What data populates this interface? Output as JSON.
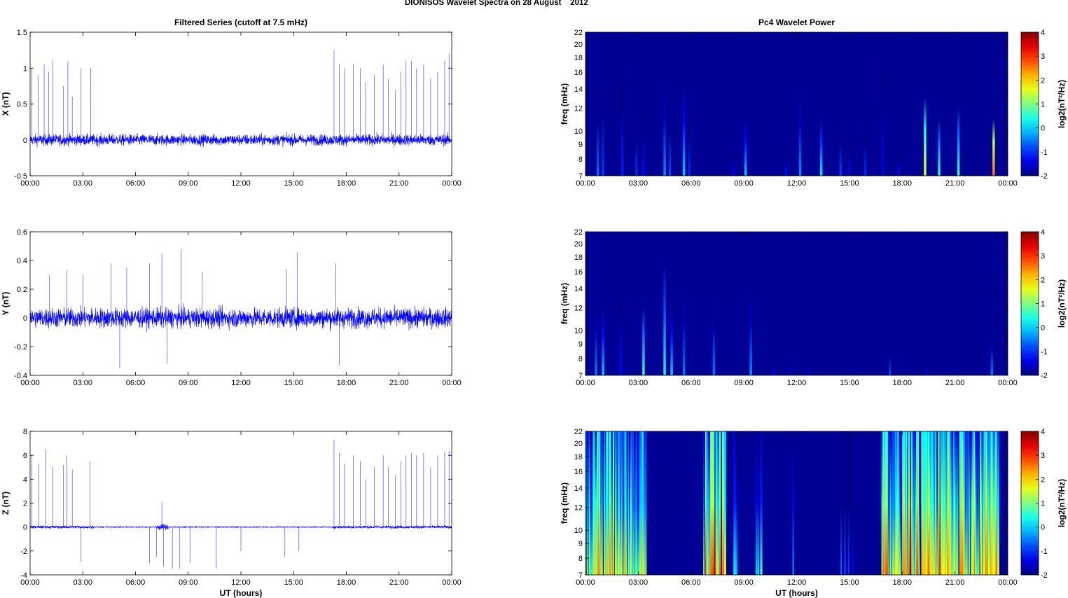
{
  "figure_title": "DIONISOS Wavelet Spectra on 28 August    2012",
  "chart_data": [
    {
      "type": "line",
      "panel": "x-series",
      "title": "Filtered Series (cutoff at 7.5 mHz)",
      "xlabel": "",
      "ylabel": "X (nT)",
      "xlim": [
        0,
        24
      ],
      "ylim": [
        -0.5,
        1.5
      ],
      "yticks": [
        "-0.5",
        "0",
        "0.5",
        "1",
        "1.5"
      ],
      "yticks_values": [
        -0.5,
        0,
        0.5,
        1,
        1.5
      ],
      "noise_amplitude": 0.08,
      "spikes": [
        [
          0.1,
          1.0
        ],
        [
          0.45,
          0.9
        ],
        [
          0.8,
          1.05
        ],
        [
          1.05,
          0.95
        ],
        [
          1.3,
          1.1
        ],
        [
          1.9,
          0.75
        ],
        [
          2.15,
          1.1
        ],
        [
          2.4,
          0.6
        ],
        [
          2.9,
          1.0
        ],
        [
          3.45,
          1.0
        ],
        [
          17.3,
          1.25
        ],
        [
          17.6,
          1.05
        ],
        [
          17.9,
          1.0
        ],
        [
          18.4,
          1.05
        ],
        [
          18.8,
          1.0
        ],
        [
          19.1,
          0.8
        ],
        [
          19.6,
          0.9
        ],
        [
          20.1,
          1.05
        ],
        [
          20.4,
          0.85
        ],
        [
          20.8,
          0.7
        ],
        [
          21.1,
          0.95
        ],
        [
          21.4,
          1.1
        ],
        [
          21.7,
          1.1
        ],
        [
          22.0,
          1.0
        ],
        [
          22.4,
          1.05
        ],
        [
          22.8,
          0.85
        ],
        [
          23.2,
          0.95
        ],
        [
          23.6,
          1.1
        ],
        [
          23.85,
          1.2
        ]
      ]
    },
    {
      "type": "line",
      "panel": "y-series",
      "title": "",
      "xlabel": "",
      "ylabel": "Y (nT)",
      "xlim": [
        0,
        24
      ],
      "ylim": [
        -0.4,
        0.6
      ],
      "yticks": [
        "-0.4",
        "-0.2",
        "0",
        "0.2",
        "0.4",
        "0.6"
      ],
      "yticks_values": [
        -0.4,
        -0.2,
        0,
        0.2,
        0.4,
        0.6
      ],
      "noise_amplitude": 0.07,
      "spikes": [
        [
          2.1,
          0.33
        ],
        [
          3.0,
          0.3
        ],
        [
          4.6,
          0.38
        ],
        [
          5.1,
          -0.35
        ],
        [
          6.8,
          0.38
        ],
        [
          7.5,
          0.45
        ],
        [
          7.8,
          -0.32
        ],
        [
          8.6,
          0.48
        ],
        [
          9.8,
          0.32
        ],
        [
          14.6,
          0.34
        ],
        [
          15.2,
          0.46
        ],
        [
          17.4,
          0.38
        ],
        [
          17.6,
          -0.33
        ],
        [
          5.5,
          0.35
        ],
        [
          1.1,
          0.3
        ]
      ]
    },
    {
      "type": "line",
      "panel": "z-series",
      "title": "",
      "xlabel": "UT (hours)",
      "ylabel": "Z (nT)",
      "xlim": [
        0,
        24
      ],
      "ylim": [
        -4,
        8
      ],
      "yticks": [
        "-4",
        "-2",
        "0",
        "2",
        "4",
        "6",
        "8"
      ],
      "yticks_values": [
        -4,
        -2,
        0,
        2,
        4,
        6,
        8
      ],
      "noise_amplitude": 0.12,
      "spikes": [
        [
          0.1,
          6.0
        ],
        [
          0.5,
          5.3
        ],
        [
          0.9,
          6.5
        ],
        [
          1.3,
          5.0
        ],
        [
          1.9,
          5.2
        ],
        [
          2.1,
          6.0
        ],
        [
          2.4,
          4.8
        ],
        [
          2.9,
          -2.9
        ],
        [
          3.4,
          5.5
        ],
        [
          6.8,
          -3.0
        ],
        [
          7.2,
          -2.5
        ],
        [
          7.5,
          2.1
        ],
        [
          7.6,
          -3.3
        ],
        [
          8.1,
          -3.5
        ],
        [
          8.5,
          -3.5
        ],
        [
          9.1,
          -3.0
        ],
        [
          10.6,
          -3.5
        ],
        [
          12.0,
          -2.0
        ],
        [
          14.5,
          -2.5
        ],
        [
          15.3,
          -2.0
        ],
        [
          17.3,
          7.3
        ],
        [
          17.6,
          6.2
        ],
        [
          17.9,
          5.3
        ],
        [
          18.4,
          6.0
        ],
        [
          18.8,
          5.5
        ],
        [
          19.1,
          4.0
        ],
        [
          19.6,
          5.0
        ],
        [
          20.1,
          6.0
        ],
        [
          20.4,
          5.0
        ],
        [
          20.8,
          4.3
        ],
        [
          21.1,
          5.5
        ],
        [
          21.4,
          6.0
        ],
        [
          21.7,
          6.2
        ],
        [
          22.0,
          6.0
        ],
        [
          22.4,
          6.2
        ],
        [
          22.8,
          5.0
        ],
        [
          23.2,
          6.0
        ],
        [
          23.6,
          6.3
        ],
        [
          23.85,
          6.4
        ]
      ]
    },
    {
      "type": "heatmap",
      "panel": "x-power",
      "title": "Pc4 Wavelet Power",
      "xlabel": "",
      "ylabel": "freq (mHz)",
      "xlim": [
        0,
        24
      ],
      "ylim": [
        7,
        22
      ],
      "yscale": "log",
      "yticks": [
        "7",
        "8",
        "9",
        "10",
        "12",
        "14",
        "16",
        "18",
        "20",
        "22"
      ],
      "yticks_values": [
        7,
        8,
        9,
        10,
        12,
        14,
        16,
        18,
        20,
        22
      ],
      "colorbar": {
        "label": "log2(nT²/Hz)",
        "ticks": [
          "-2",
          "-1",
          "0",
          "1",
          "2",
          "3",
          "4"
        ],
        "clim": [
          -2,
          4
        ],
        "colormap": "jet"
      },
      "bursts": [
        [
          0.7,
          14,
          -0.6
        ],
        [
          1.0,
          16,
          -0.9
        ],
        [
          2.1,
          18,
          -1.1
        ],
        [
          2.9,
          12,
          -1.0
        ],
        [
          3.3,
          13,
          -1.2
        ],
        [
          4.5,
          15,
          -0.4
        ],
        [
          4.8,
          13,
          -0.8
        ],
        [
          5.6,
          14,
          0.0
        ],
        [
          5.9,
          12,
          -1.0
        ],
        [
          8.4,
          9,
          -1.3
        ],
        [
          9.1,
          11,
          0.0
        ],
        [
          11.4,
          9,
          -1.2
        ],
        [
          12.2,
          14,
          -0.4
        ],
        [
          13.4,
          11,
          0.2
        ],
        [
          14.5,
          11,
          -0.9
        ],
        [
          15.0,
          10,
          -1.2
        ],
        [
          15.9,
          11,
          -1.0
        ],
        [
          16.9,
          22,
          -1.4
        ],
        [
          17.8,
          9,
          -1.2
        ],
        [
          19.3,
          13,
          1.6
        ],
        [
          20.1,
          11,
          0.6
        ],
        [
          21.2,
          12,
          0.6
        ],
        [
          23.2,
          11,
          2.6
        ]
      ]
    },
    {
      "type": "heatmap",
      "panel": "y-power",
      "title": "",
      "xlabel": "",
      "ylabel": "freq (mHz)",
      "xlim": [
        0,
        24
      ],
      "ylim": [
        7,
        22
      ],
      "yscale": "log",
      "yticks": [
        "7",
        "8",
        "9",
        "10",
        "12",
        "14",
        "16",
        "18",
        "20",
        "22"
      ],
      "yticks_values": [
        7,
        8,
        9,
        10,
        12,
        14,
        16,
        18,
        20,
        22
      ],
      "colorbar": {
        "label": "log2(nT²/Hz)",
        "ticks": [
          "-2",
          "-1",
          "0",
          "1",
          "2",
          "3",
          "4"
        ],
        "clim": [
          -2,
          4
        ],
        "colormap": "jet"
      },
      "bursts": [
        [
          0.6,
          13,
          -0.5
        ],
        [
          1.0,
          12,
          0.0
        ],
        [
          2.0,
          16,
          -1.2
        ],
        [
          3.3,
          12,
          0.6
        ],
        [
          4.5,
          17,
          0.4
        ],
        [
          4.9,
          12,
          0.0
        ],
        [
          5.6,
          14,
          -0.5
        ],
        [
          7.3,
          13,
          -0.5
        ],
        [
          9.4,
          14,
          -0.4
        ],
        [
          10.7,
          8,
          -1.2
        ],
        [
          11.6,
          8,
          -1.4
        ],
        [
          12.7,
          8,
          -1.4
        ],
        [
          17.3,
          9,
          -0.8
        ],
        [
          19.4,
          8,
          -1.4
        ],
        [
          23.1,
          10,
          -0.5
        ]
      ]
    },
    {
      "type": "heatmap",
      "panel": "z-power",
      "title": "",
      "xlabel": "UT (hours)",
      "ylabel": "freq (mHz)",
      "xlim": [
        0,
        24
      ],
      "ylim": [
        7,
        22
      ],
      "yscale": "log",
      "yticks": [
        "7",
        "8",
        "9",
        "10",
        "12",
        "14",
        "16",
        "18",
        "20",
        "22"
      ],
      "yticks_values": [
        7,
        8,
        9,
        10,
        12,
        14,
        16,
        18,
        20,
        22
      ],
      "colorbar": {
        "label": "log2(nT²/Hz)",
        "ticks": [
          "-2",
          "-1",
          "0",
          "1",
          "2",
          "3",
          "4"
        ],
        "clim": [
          -2,
          4
        ],
        "colormap": "jet"
      },
      "active_intervals": [
        [
          0.0,
          3.5,
          38,
          2.5
        ],
        [
          6.7,
          8.0,
          14,
          3.0
        ],
        [
          8.4,
          8.7,
          3,
          1.5
        ],
        [
          9.7,
          10.0,
          3,
          1.0
        ],
        [
          11.8,
          11.9,
          1,
          0.5
        ],
        [
          14.5,
          15.3,
          4,
          0.5
        ],
        [
          16.8,
          23.5,
          80,
          2.8
        ]
      ]
    }
  ],
  "xticks": [
    "00:00",
    "03:00",
    "06:00",
    "09:00",
    "12:00",
    "15:00",
    "18:00",
    "21:00",
    "00:00"
  ],
  "xticks_values": [
    0,
    3,
    6,
    9,
    12,
    15,
    18,
    21,
    24
  ]
}
